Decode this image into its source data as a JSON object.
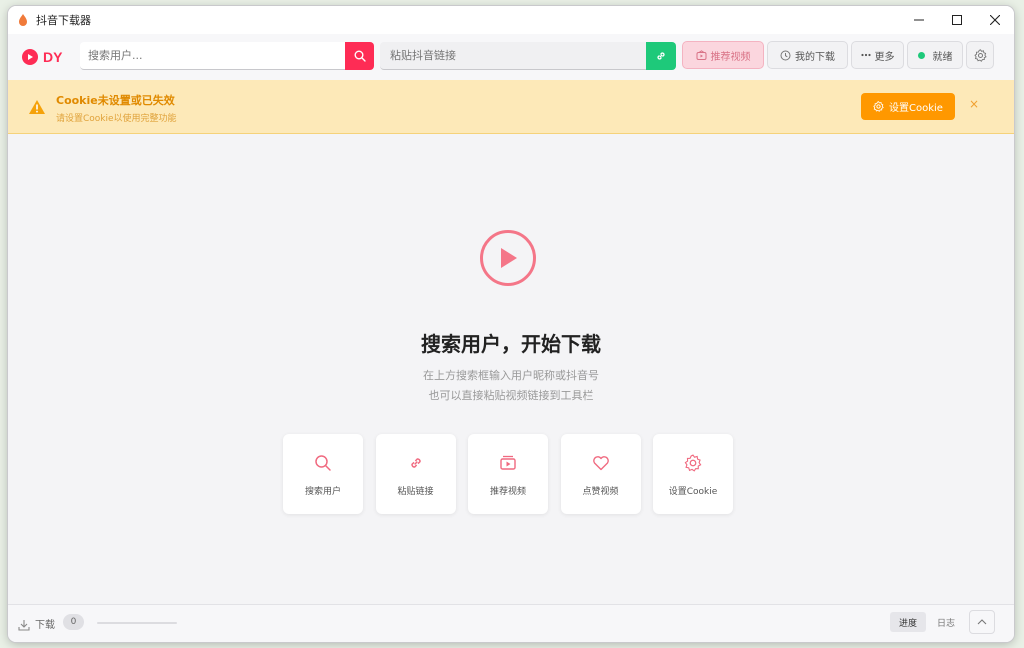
{
  "window": {
    "title": "抖音下载器",
    "controls": [
      "minimize-icon",
      "maximize-icon",
      "close-icon"
    ]
  },
  "toolbar": {
    "logo_text": "DY",
    "search_placeholder": "搜索用户...",
    "link_placeholder": "粘贴抖音链接",
    "recommend_label": "推荐视频",
    "my_downloads_label": "我的下载",
    "more_label": "更多",
    "status_label": "就绪"
  },
  "banner": {
    "title": "Cookie未设置或已失效",
    "subtitle": "请设置Cookie以使用完整功能",
    "button_label": "设置Cookie",
    "close_label": "×"
  },
  "main": {
    "title": "搜索用户，开始下载",
    "subtitle_line1": "在上方搜索框输入用户昵称或抖音号",
    "subtitle_line2": "也可以直接粘贴视频链接到工具栏",
    "cards": [
      {
        "label": "搜索用户",
        "icon": "search-icon"
      },
      {
        "label": "粘贴链接",
        "icon": "link-icon"
      },
      {
        "label": "推荐视频",
        "icon": "video-list-icon"
      },
      {
        "label": "点赞视频",
        "icon": "heart-icon"
      },
      {
        "label": "设置Cookie",
        "icon": "gear-icon"
      }
    ]
  },
  "statusbar": {
    "download_label": "下载",
    "download_count": "0",
    "progress": 0,
    "tab_progress": "进度",
    "tab_log": "日志"
  },
  "colors": {
    "brand": "#fe2c55",
    "success": "#1ec97a",
    "warning": "#ff9800",
    "banner_bg": "#fde9b8"
  }
}
